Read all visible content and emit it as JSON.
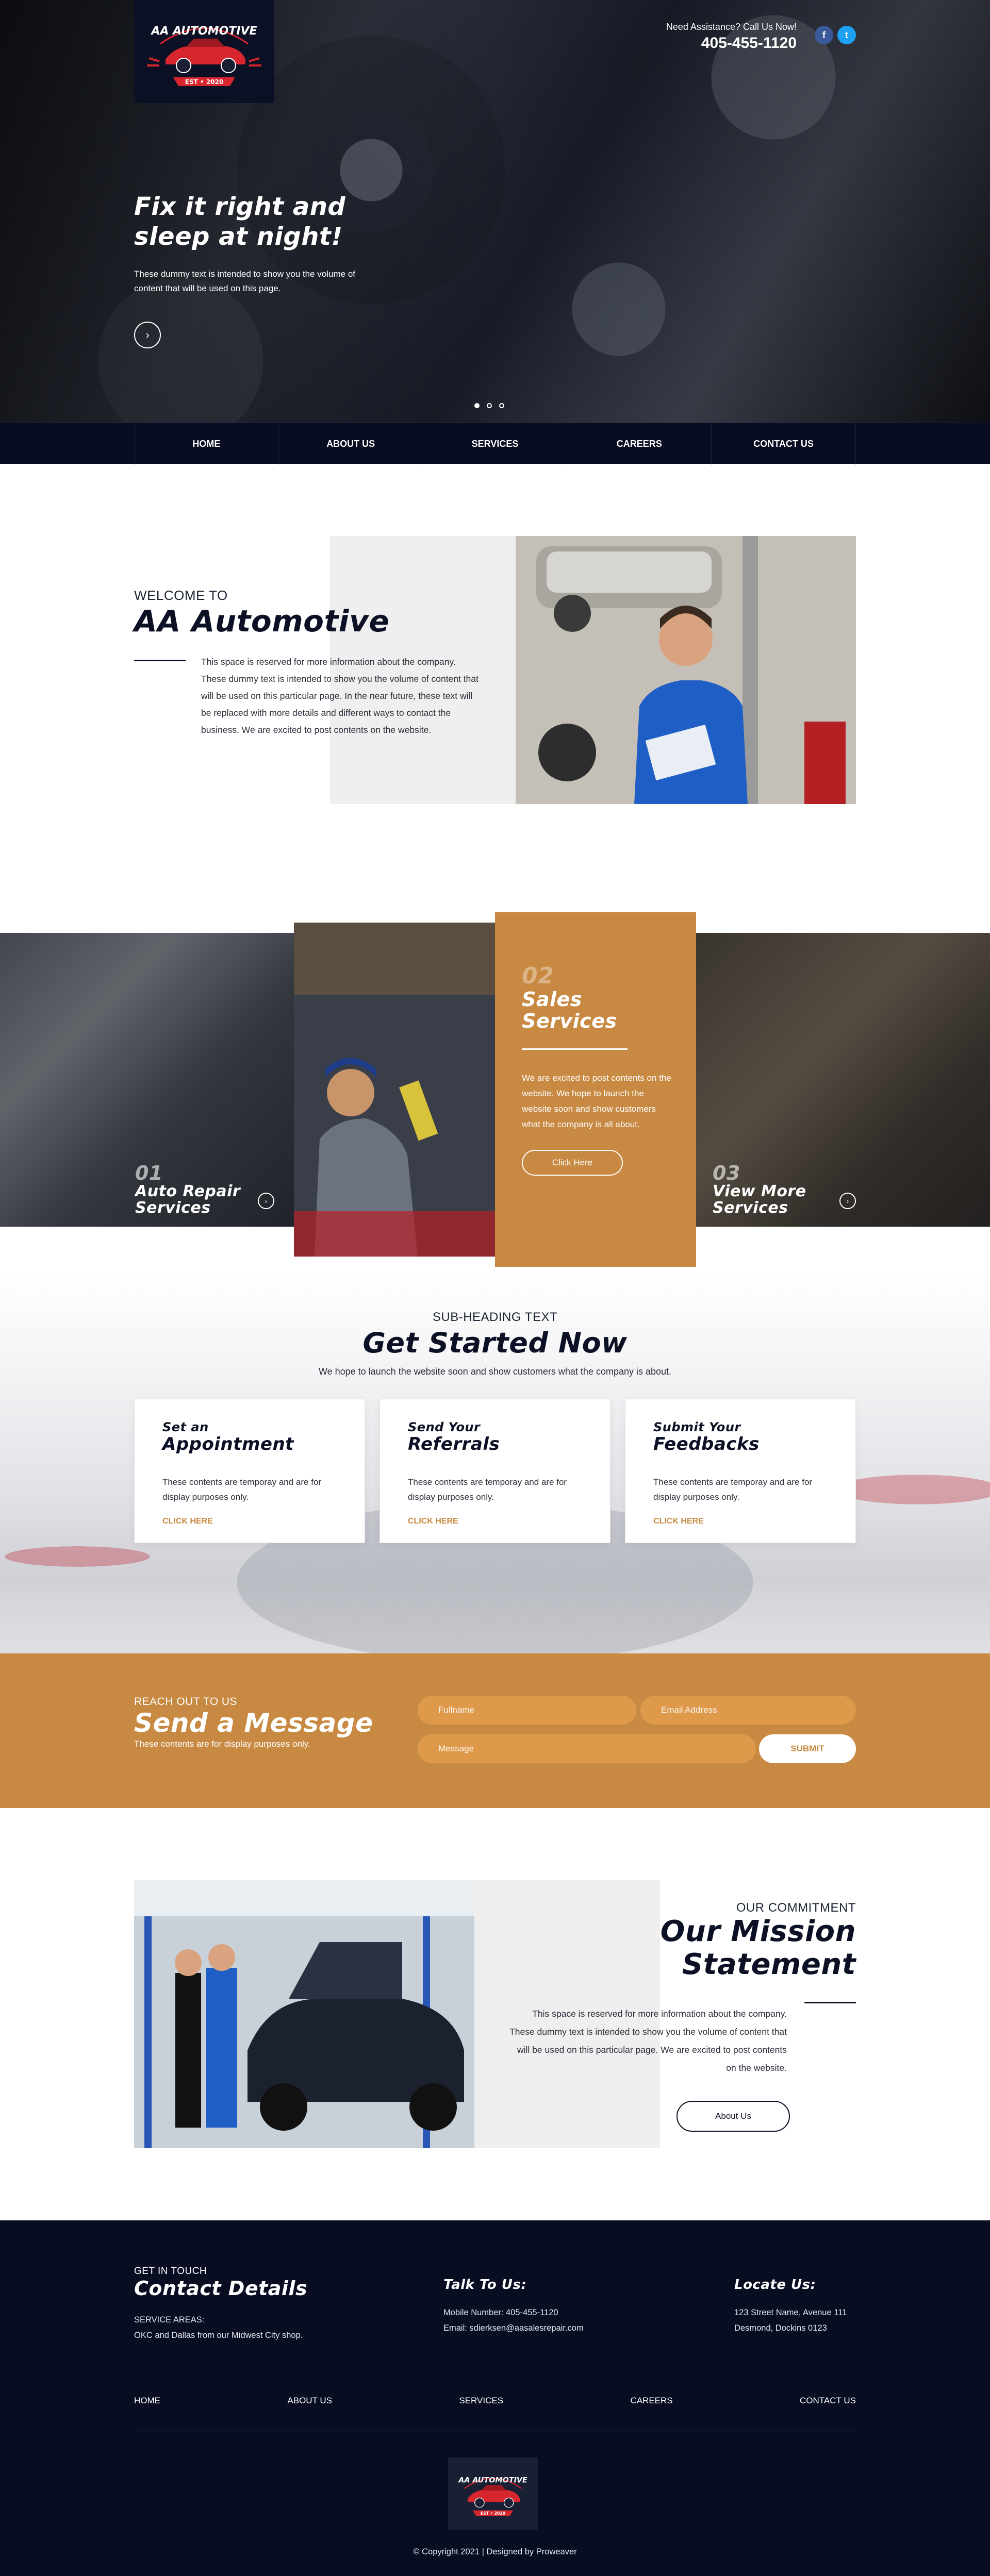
{
  "brand": {
    "logo_text": "AA AUTOMOTIVE",
    "logo_est": "EST • 2020"
  },
  "header": {
    "assistance": "Need Assistance? Call Us Now!",
    "phone": "405-455-1120",
    "social": {
      "facebook": "f",
      "twitter": "t"
    }
  },
  "hero": {
    "title_line1": "Fix it right and",
    "title_line2": "sleep at night!",
    "body": "These dummy text is intended to show you the volume of content that will be used on this page.",
    "arrow": "›",
    "active_slide": 1,
    "slide_count": 3
  },
  "nav": {
    "items": [
      "HOME",
      "ABOUT US",
      "SERVICES",
      "CAREERS",
      "CONTACT US"
    ]
  },
  "welcome": {
    "pre": "WELCOME TO",
    "title": "AA Automotive",
    "body": "This space is reserved for more information about the company. These dummy text is intended to show you the volume of content that will be used on this particular page. In the near future, these text will be replaced with more details and different ways to contact the business. We are excited to post contents on the website."
  },
  "services": {
    "items": [
      {
        "num": "01",
        "title_line1": "Auto Repair",
        "title_line2": "Services"
      },
      {
        "num": "02",
        "title_line1": "Sales",
        "title_line2": "Services",
        "body": "We are excited to post contents on the website. We hope to launch the website soon and show customers what the company is all about.",
        "button": "Click Here"
      },
      {
        "num": "03",
        "title_line1": "View More",
        "title_line2": "Services"
      }
    ],
    "arrow": "›"
  },
  "get_started": {
    "pre": "SUB-HEADING TEXT",
    "title": "Get Started Now",
    "lede": "We hope to launch the website soon and show customers what the company is about.",
    "cards": [
      {
        "pre": "Set an",
        "main": "Appointment",
        "body": "These contents are temporay and are for display purposes only.",
        "link": "CLICK HERE"
      },
      {
        "pre": "Send Your",
        "main": "Referrals",
        "body": "These contents are temporay and are for display purposes only.",
        "link": "CLICK HERE"
      },
      {
        "pre": "Submit Your",
        "main": "Feedbacks",
        "body": "These contents are temporay and are for display purposes only.",
        "link": "CLICK HERE"
      }
    ]
  },
  "message": {
    "pre": "REACH OUT TO US",
    "title": "Send a Message",
    "note": "These contents are for display purposes only.",
    "fullname_placeholder": "Fullname",
    "email_placeholder": "Email Address",
    "message_placeholder": "Message",
    "submit": "SUBMIT"
  },
  "mission": {
    "pre": "OUR COMMITMENT",
    "title_line1": "Our Mission",
    "title_line2": "Statement",
    "body": "This space is reserved for more information about the company. These dummy text is intended to show you the volume of content that will be used on this particular page. We are excited to post contents on the website.",
    "button": "About Us"
  },
  "footer": {
    "contact_pre": "GET IN TOUCH",
    "contact_title": "Contact Details",
    "service_areas_label": "SERVICE AREAS:",
    "service_areas": "OKC and Dallas from our Midwest City shop.",
    "talk_title": "Talk To Us:",
    "mobile": "Mobile Number:  405-455-1120",
    "email": "Email:  sdierksen@aasalesrepair.com",
    "locate_title": "Locate Us:",
    "address_line1": "123 Street Name, Avenue 111",
    "address_line2": "Desmond, Dockins 0123",
    "nav": [
      "HOME",
      "ABOUT US",
      "SERVICES",
      "CAREERS",
      "CONTACT US"
    ],
    "copyright": "© Copyright 2021  |  Designed by Proweaver"
  },
  "colors": {
    "navy": "#0b1024",
    "footer_navy": "#080d22",
    "accent_orange": "#c88a42",
    "logo_red": "#d8262f"
  }
}
